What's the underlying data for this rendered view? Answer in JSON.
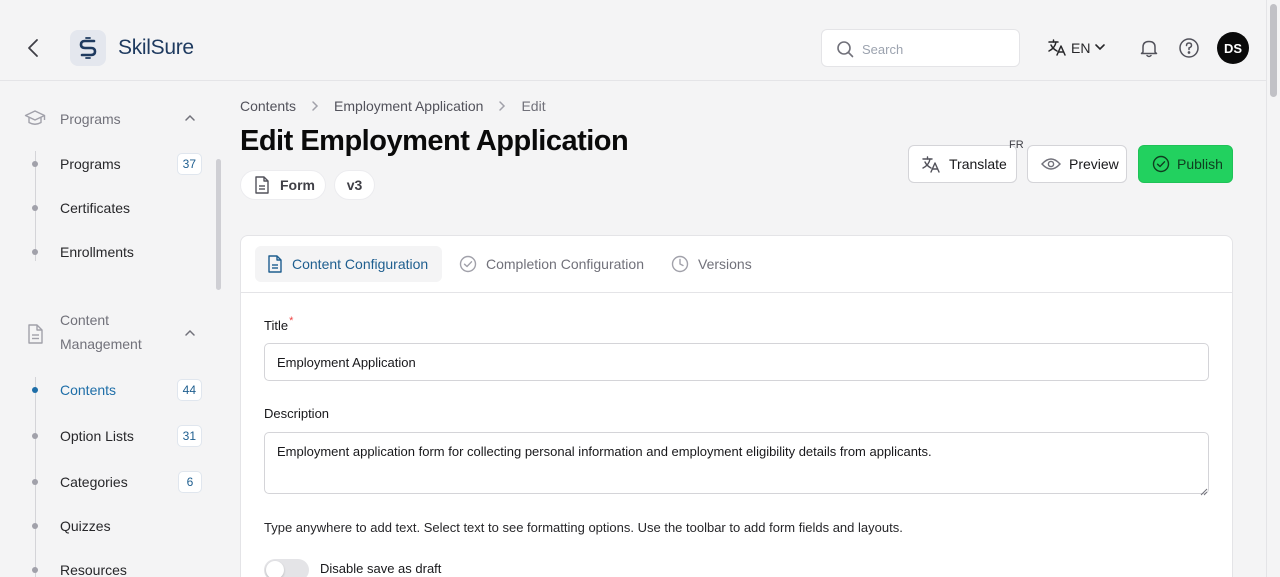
{
  "app": {
    "name": "SkilSure"
  },
  "header": {
    "search_placeholder": "Search",
    "language": "EN",
    "avatar_initials": "DS"
  },
  "sidebar": {
    "sections": [
      {
        "label": "Programs",
        "items": [
          {
            "label": "Programs",
            "count": "37"
          },
          {
            "label": "Certificates"
          },
          {
            "label": "Enrollments"
          }
        ]
      },
      {
        "label": "Content Management",
        "items": [
          {
            "label": "Contents",
            "count": "44",
            "active": true
          },
          {
            "label": "Option Lists",
            "count": "31"
          },
          {
            "label": "Categories",
            "count": "6"
          },
          {
            "label": "Quizzes"
          },
          {
            "label": "Resources"
          }
        ]
      }
    ]
  },
  "breadcrumb": [
    "Contents",
    "Employment Application",
    "Edit"
  ],
  "page": {
    "title": "Edit Employment Application",
    "type_chip": "Form",
    "version_chip": "v3"
  },
  "actions": {
    "translate": "Translate",
    "translate_badge": "FR",
    "preview": "Preview",
    "publish": "Publish"
  },
  "tabs": [
    "Content Configuration",
    "Completion Configuration",
    "Versions"
  ],
  "form": {
    "title_label": "Title",
    "title_required": "*",
    "title_value": "Employment Application",
    "description_label": "Description",
    "description_value": "Employment application form for collecting personal information and employment eligibility details from applicants.",
    "hint": "Type anywhere to add text. Select text to see formatting options. Use the toolbar to add form fields and layouts.",
    "draft_toggle_label": "Disable save as draft"
  },
  "colors": {
    "accent": "#1e6ea8",
    "publish": "#22d15f",
    "required": "#ef4444"
  }
}
